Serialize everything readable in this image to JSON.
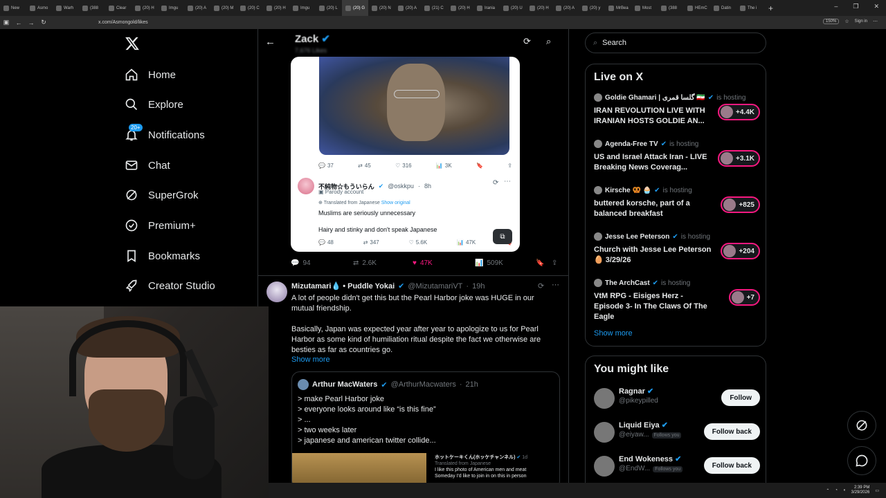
{
  "browser": {
    "tabs": [
      "New",
      "Asmo",
      "Warh",
      "(388",
      "Clear",
      "(20) H",
      "Imgu",
      "(20) A",
      "(20) M",
      "(20) C",
      "(20) H",
      "Imgu",
      "(20) L",
      "(20) G",
      "(20) N",
      "(20) A",
      "(21) C",
      "(20) H",
      "Irania",
      "(20) U",
      "(20) H",
      "(20) A",
      "(20) y",
      "MrBea",
      "Most",
      "(388",
      "HEmC",
      "Datin",
      "The i"
    ],
    "active_tab_index": 13,
    "new_tab": "+",
    "url": "x.com/Asmongold/likes",
    "zoom": "150%",
    "sign_in": "Sign in",
    "window_controls": [
      "–",
      "❐",
      "✕"
    ]
  },
  "nav": {
    "items": [
      {
        "label": "Home",
        "icon": "home-icon"
      },
      {
        "label": "Explore",
        "icon": "search-icon"
      },
      {
        "label": "Notifications",
        "icon": "bell-icon",
        "badge": "20+"
      },
      {
        "label": "Chat",
        "icon": "mail-icon"
      },
      {
        "label": "SuperGrok",
        "icon": "grok-icon"
      },
      {
        "label": "Premium+",
        "icon": "verified-icon"
      },
      {
        "label": "Bookmarks",
        "icon": "bookmark-icon"
      },
      {
        "label": "Creator Studio",
        "icon": "rocket-icon"
      }
    ]
  },
  "header": {
    "name": "Zack",
    "subtitle": "7,676 Likes"
  },
  "quoted_post": {
    "stats": {
      "replies": "37",
      "reposts": "45",
      "likes": "316",
      "views": "3K"
    },
    "inner": {
      "name": "不純物☆もういらん",
      "handle": "@oskkpu",
      "time": "8h",
      "badge": "Parody account",
      "translated": "Translated from Japanese",
      "show_original": "Show original",
      "line1": "Muslims are seriously unnecessary",
      "line2": "Hairy and stinky and don't speak Japanese",
      "stats": {
        "replies": "48",
        "reposts": "347",
        "likes": "5.6K",
        "views": "47K"
      }
    }
  },
  "post_actions": {
    "replies": "94",
    "reposts": "2.6K",
    "likes": "47K",
    "views": "509K"
  },
  "tweet2": {
    "name": "Mizutamari💧 • Puddle Yokai",
    "handle": "@MizutamariVT",
    "time": "19h",
    "line1": "A lot of people didn't get this but the Pearl Harbor joke was HUGE in our",
    "line2": "mutual friendship.",
    "line3": "Basically, Japan was expected year after year to apologize to us for Pearl",
    "line4": "Harbor as some kind of humiliation ritual despite the fact we otherwise are",
    "line5": "besties as far as countries go.",
    "show_more": "Show more",
    "quote": {
      "name": "Arthur MacWaters",
      "handle": "@ArthurMacwaters",
      "time": "21h",
      "lines": [
        "> make Pearl Harbor joke",
        "> everyone looks around like “is this fine”",
        "> ...",
        "> two weeks later",
        "> japanese and american twitter collide..."
      ],
      "mini_name": "ホットケーキくん(ホッケチャンネル)",
      "mini_time": "1d",
      "mini_translated": "Translated from Japanese",
      "mini_line1": "I like this photo of American men and meat",
      "mini_line2": "Someday I'd like to join in on this in person"
    }
  },
  "right": {
    "search_placeholder": "Search",
    "live_title": "Live on X",
    "hosting_label": "is hosting",
    "live_items": [
      {
        "host": "Goldie Ghamari | گلسا قمری 🇮🇷",
        "title": "IRAN REVOLUTION LIVE WITH IRANIAN HOSTS GOLDIE AN...",
        "count": "+4.4K"
      },
      {
        "host": "Agenda-Free TV",
        "title": "US and Israel Attack Iran - LIVE Breaking News Coverag...",
        "count": "+3.1K"
      },
      {
        "host": "Kirsche 🥨 🧁",
        "title": "buttered korsche, part of a balanced breakfast",
        "count": "+825"
      },
      {
        "host": "Jesse Lee Peterson",
        "title": "Church with Jesse Lee Peterson 🥚 3/29/26",
        "count": "+204"
      },
      {
        "host": "The ArchCast",
        "title": "VtM RPG - Eisiges Herz - Episode 3- In The Claws Of The Eagle",
        "count": "+7"
      }
    ],
    "show_more": "Show more",
    "wtf_title": "You might like",
    "follows": [
      {
        "name": "Ragnar",
        "handle": "@pikeypilled",
        "you": "",
        "button": "Follow"
      },
      {
        "name": "Liquid Eiya",
        "handle": "@eiyaw...",
        "you": "Follows you",
        "button": "Follow back"
      },
      {
        "name": "End Wokeness",
        "handle": "@EndW...",
        "you": "Follows you",
        "button": "Follow back"
      }
    ]
  },
  "taskbar": {
    "time": "2:39 PM",
    "date": "3/29/2026"
  },
  "colors": {
    "accent": "#1d9bf0",
    "live": "#f91880",
    "bg": "#000000"
  }
}
